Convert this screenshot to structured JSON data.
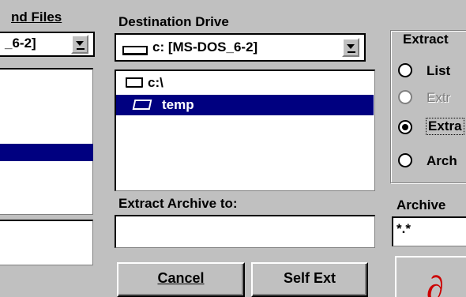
{
  "left_panel": {
    "header": "nd Files",
    "drive_combo_text": "_6-2]"
  },
  "destination": {
    "header": "Destination Drive",
    "drive_combo_text": "c: [MS-DOS_6-2]",
    "tree": [
      {
        "label": "c:\\",
        "icon": "folder-closed-icon",
        "selected": false
      },
      {
        "label": "temp",
        "icon": "folder-open-icon",
        "selected": true
      }
    ]
  },
  "extract_to": {
    "label": "Extract Archive to:",
    "value": ""
  },
  "extract_group": {
    "title": "Extract",
    "options": [
      {
        "label": "List",
        "checked": false,
        "enabled": true
      },
      {
        "label": "Extr",
        "checked": false,
        "enabled": false
      },
      {
        "label": "Extra",
        "checked": true,
        "enabled": true
      },
      {
        "label": "Arch",
        "checked": false,
        "enabled": true
      }
    ]
  },
  "archive": {
    "label": "Archive",
    "value": "*.*"
  },
  "buttons": {
    "cancel": "Cancel",
    "self_ext": "Self Ext"
  }
}
